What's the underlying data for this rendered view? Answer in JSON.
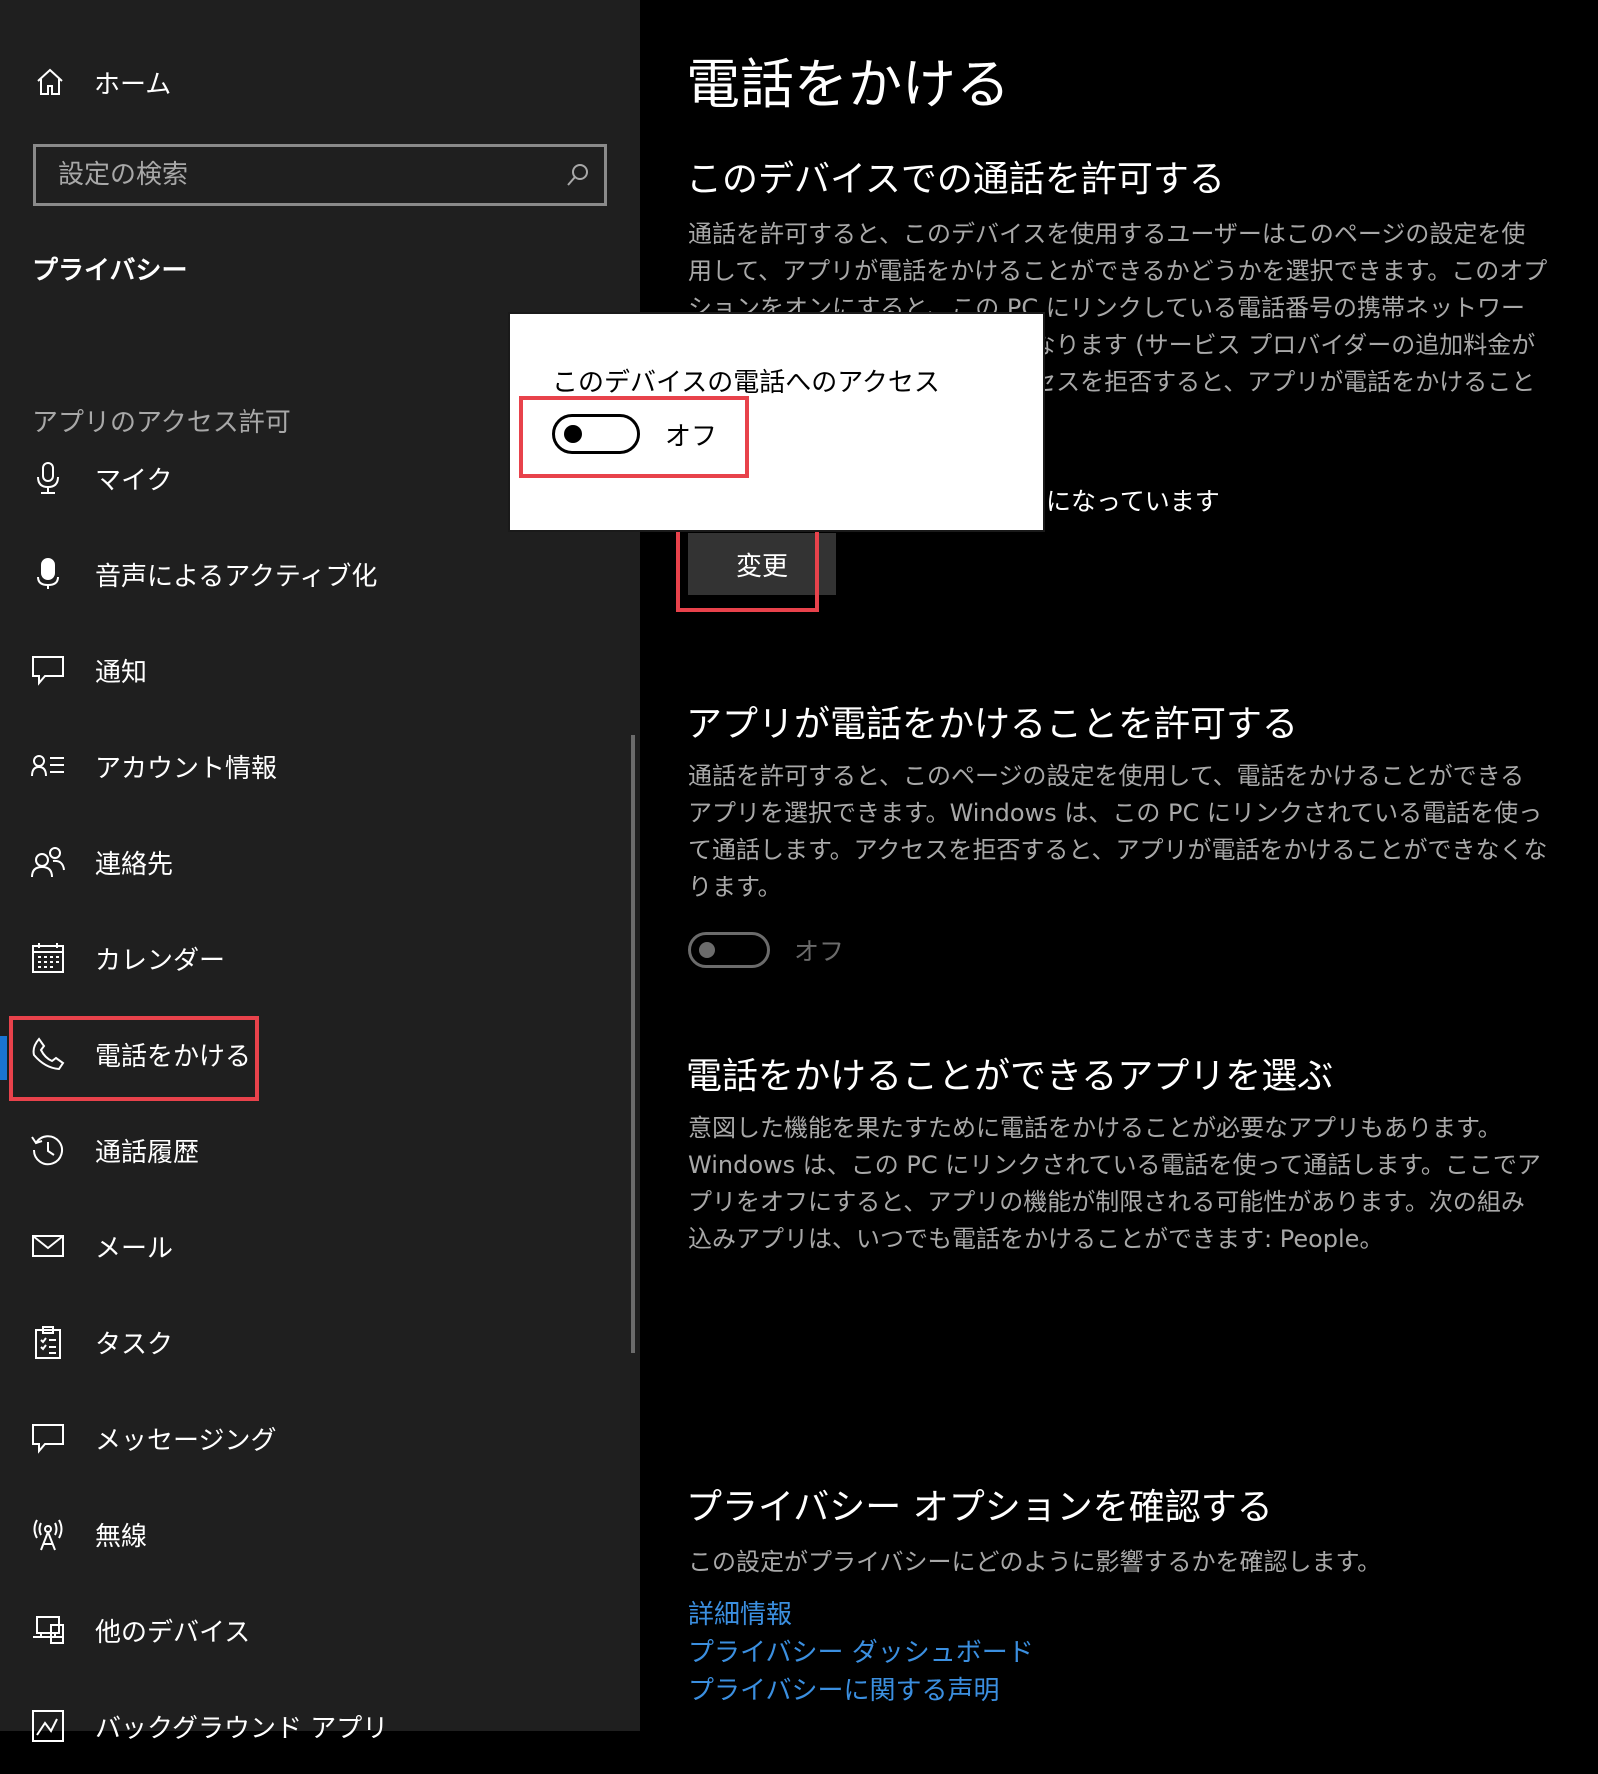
{
  "sidebar": {
    "home_label": "ホーム",
    "search_placeholder": "設定の検索",
    "section_title": "プライバシー",
    "group_label": "アプリのアクセス許可",
    "items": [
      {
        "label": "マイク",
        "icon": "microphone-icon"
      },
      {
        "label": "音声によるアクティブ化",
        "icon": "voice-activation-icon"
      },
      {
        "label": "通知",
        "icon": "notification-icon"
      },
      {
        "label": "アカウント情報",
        "icon": "account-info-icon"
      },
      {
        "label": "連絡先",
        "icon": "contacts-icon"
      },
      {
        "label": "カレンダー",
        "icon": "calendar-icon"
      },
      {
        "label": "電話をかける",
        "icon": "phone-icon",
        "active": true
      },
      {
        "label": "通話履歴",
        "icon": "history-icon"
      },
      {
        "label": "メール",
        "icon": "mail-icon"
      },
      {
        "label": "タスク",
        "icon": "tasks-icon"
      },
      {
        "label": "メッセージング",
        "icon": "messaging-icon"
      },
      {
        "label": "無線",
        "icon": "radio-icon"
      },
      {
        "label": "他のデバイス",
        "icon": "other-devices-icon"
      },
      {
        "label": "バックグラウンド アプリ",
        "icon": "background-apps-icon"
      }
    ]
  },
  "main": {
    "title": "電話をかける",
    "section1": {
      "heading": "このデバイスでの通話を許可する",
      "description": "通話を許可すると、このデバイスを使用するユーザーはこのページの設定を使用して、アプリが電話をかけることができるかどうかを選択できます。このオプションをオンにすると、この PC にリンクしている電話番号の携帯ネットワーク サービスが使用されるようになります (サービス プロバイダーの追加料金が発生する場合があります)。アクセスを拒否すると、アプリが電話をかけることができなくなります。",
      "status_suffix": "になっています",
      "change_button": "変更"
    },
    "section2": {
      "heading": "アプリが電話をかけることを許可する",
      "description": "通話を許可すると、このページの設定を使用して、電話をかけることができるアプリを選択できます。Windows は、この PC にリンクされている電話を使って通話します。アクセスを拒否すると、アプリが電話をかけることができなくなります。",
      "toggle_label": "オフ",
      "toggle_on": false
    },
    "section3": {
      "heading": "電話をかけることができるアプリを選ぶ",
      "description": "意図した機能を果たすために電話をかけることが必要なアプリもあります。Windows は、この PC にリンクされている電話を使って通話します。ここでアプリをオフにすると、アプリの機能が制限される可能性があります。次の組み込みアプリは、いつでも電話をかけることができます: People。"
    },
    "section4": {
      "heading": "プライバシー オプションを確認する",
      "description": "この設定がプライバシーにどのように影響するかを確認します。",
      "links": [
        "詳細情報",
        "プライバシー ダッシュボード",
        "プライバシーに関する声明"
      ]
    }
  },
  "popup": {
    "title": "このデバイスの電話へのアクセス",
    "toggle_label": "オフ",
    "toggle_on": false
  },
  "colors": {
    "sidebar_bg": "#1f1f1f",
    "main_bg": "#000000",
    "accent": "#1a75d2",
    "highlight": "#e8424b",
    "link": "#3b8fe0"
  }
}
